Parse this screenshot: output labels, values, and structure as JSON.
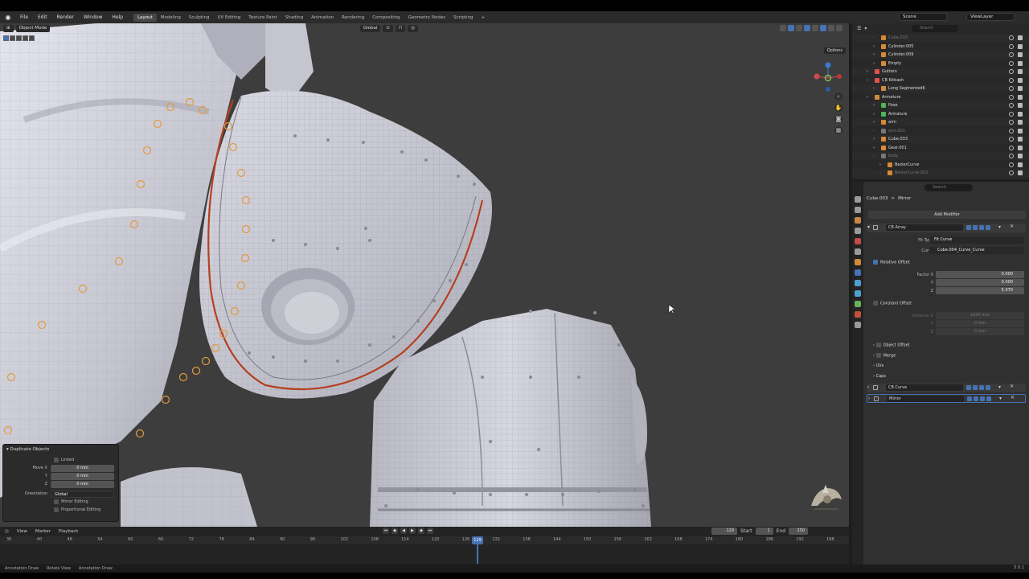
{
  "menu": [
    "File",
    "Edit",
    "Render",
    "Window",
    "Help"
  ],
  "workspaces": [
    "Layout",
    "Modeling",
    "Sculpting",
    "UV Editing",
    "Texture Paint",
    "Shading",
    "Animation",
    "Rendering",
    "Compositing",
    "Geometry Nodes",
    "Scripting"
  ],
  "active_workspace": "Layout",
  "scene_name": "Scene",
  "view_layer": "ViewLayer",
  "viewport": {
    "mode": "Object Mode",
    "menus": [
      "View",
      "Select",
      "Add",
      "Object"
    ],
    "transform": "Global",
    "view_name": "User Perspective",
    "collection_info": "(129) Scene Collection | Cube.003",
    "options_label": "Options"
  },
  "duplicate_panel": {
    "title": "Duplicate Objects",
    "linked": "Linked",
    "move_x_label": "Move X",
    "y_label": "Y",
    "z_label": "Z",
    "move_x": "0 mm",
    "move_y": "0 mm",
    "move_z": "0 mm",
    "orientation_label": "Orientation",
    "orientation": "Global",
    "mirror_editing": "Mirror Editing",
    "proportional_editing": "Proportional Editing"
  },
  "timeline": {
    "menus": [
      "View",
      "Marker",
      "Playback"
    ],
    "current_frame": "129",
    "start_label": "Start",
    "start": "1",
    "end_label": "End",
    "end": "250",
    "ticks": [
      "36",
      "40",
      "48",
      "54",
      "60",
      "66",
      "72",
      "78",
      "84",
      "90",
      "96",
      "102",
      "108",
      "114",
      "120",
      "126",
      "132",
      "138",
      "144",
      "150",
      "156",
      "162",
      "168",
      "174",
      "180",
      "186",
      "192",
      "198"
    ],
    "playhead": "129"
  },
  "status": {
    "items": [
      "Annotation Draw",
      "Rotate View",
      "Annotation Draw"
    ],
    "version": "5.0.1"
  },
  "outliner": {
    "search_placeholder": "Search",
    "rows": [
      {
        "name": "Cube.010",
        "indent": 36,
        "color": "#d6893b",
        "dim": true
      },
      {
        "name": "Cylinder.005",
        "indent": 36,
        "color": "#d6893b",
        "dim": false
      },
      {
        "name": "Cylinder.009",
        "indent": 36,
        "color": "#d6893b",
        "dim": false
      },
      {
        "name": "Empty",
        "indent": 36,
        "color": "#d6893b",
        "dim": false
      },
      {
        "name": "Gutters",
        "indent": 28,
        "color": "#e05050",
        "dim": false
      },
      {
        "name": "CB Kitbash",
        "indent": 28,
        "color": "#e05050",
        "dim": false
      },
      {
        "name": "Long Segmented6",
        "indent": 36,
        "color": "#d6893b",
        "dim": false
      },
      {
        "name": "Armature",
        "indent": 28,
        "color": "#d6893b",
        "dim": false
      },
      {
        "name": "Pose",
        "indent": 36,
        "color": "#4fb55a",
        "dim": false
      },
      {
        "name": "Armature",
        "indent": 36,
        "color": "#4fb55a",
        "dim": false
      },
      {
        "name": "arm",
        "indent": 36,
        "color": "#d6893b",
        "dim": false
      },
      {
        "name": "arm.001",
        "indent": 36,
        "color": "#777777",
        "dim": true
      },
      {
        "name": "Cube.033",
        "indent": 36,
        "color": "#d6893b",
        "dim": false
      },
      {
        "name": "Gear.001",
        "indent": 36,
        "color": "#d6893b",
        "dim": false
      },
      {
        "name": "body",
        "indent": 36,
        "color": "#777777",
        "dim": true
      },
      {
        "name": "BezierCurve",
        "indent": 44,
        "color": "#d6893b",
        "dim": false
      },
      {
        "name": "BezierCurve.001",
        "indent": 44,
        "color": "#d6893b",
        "dim": true
      }
    ]
  },
  "properties": {
    "search_placeholder": "Search",
    "breadcrumb_object": "Cube.003",
    "breadcrumb_sep": ">",
    "breadcrumb_modifier": "Mirror",
    "add_modifier": "Add Modifier",
    "modifiers": [
      {
        "name": "CB Array"
      },
      {
        "name": "CB Curve"
      },
      {
        "name": "Mirror"
      }
    ],
    "fit_type_label": "Fit Type",
    "fit_type": "Fit Curve",
    "curve_label": "Curve",
    "curve": "Cube.004_Curve_Curve",
    "relative_offset": "Relative Offset",
    "factor_x_label": "Factor X",
    "y_label": "Y",
    "z_label": "Z",
    "factor_x": "0.000",
    "factor_y": "0.000",
    "factor_z": "5.070",
    "constant_offset": "Constant Offset",
    "distance_x_label": "Distance X",
    "distance_x": "1000 mm",
    "distance_y": "0 mm",
    "distance_z": "0 mm",
    "object_offset": "Object Offset",
    "merge": "Merge",
    "uvs": "UVs",
    "caps": "Caps"
  },
  "colors": {
    "accent": "#4772b3",
    "viewport_bg": "#3d3d3d",
    "mesh": "#c9c9d4",
    "seam": "#b5401f",
    "selected_vertex": "#e39a3c"
  }
}
